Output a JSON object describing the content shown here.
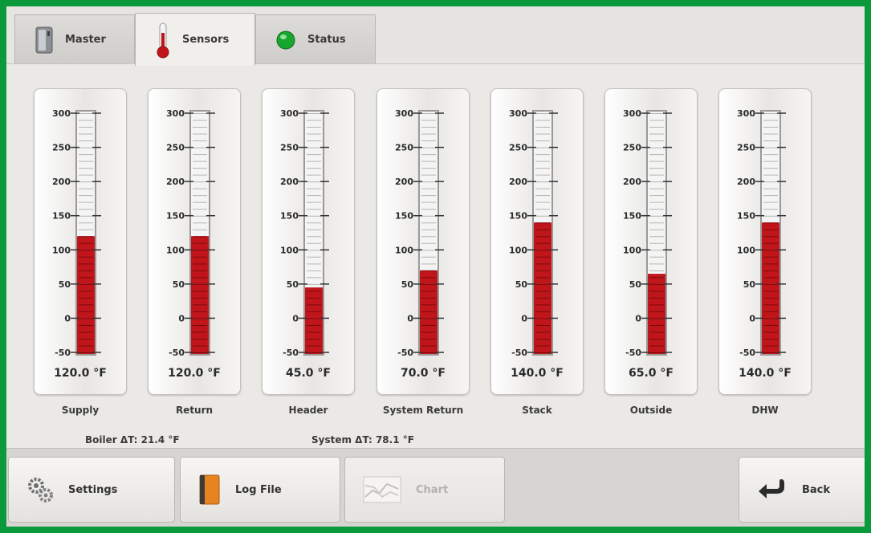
{
  "tabs": [
    {
      "label": "Master",
      "icon": "boiler-icon",
      "active": false
    },
    {
      "label": "Sensors",
      "icon": "thermometer-icon",
      "active": true
    },
    {
      "label": "Status",
      "icon": "green-led-icon",
      "active": false
    }
  ],
  "scale": {
    "min": -50,
    "max": 300,
    "ticks": [
      "300",
      "250",
      "200",
      "150",
      "100",
      "50",
      "0",
      "-50"
    ]
  },
  "sensors": [
    {
      "label": "Supply",
      "value": 120.0,
      "reading": "120.0 °F"
    },
    {
      "label": "Return",
      "value": 120.0,
      "reading": "120.0 °F"
    },
    {
      "label": "Header",
      "value": 45.0,
      "reading": "45.0 °F"
    },
    {
      "label": "System Return",
      "value": 70.0,
      "reading": "70.0 °F"
    },
    {
      "label": "Stack",
      "value": 140.0,
      "reading": "140.0 °F"
    },
    {
      "label": "Outside",
      "value": 65.0,
      "reading": "65.0 °F"
    },
    {
      "label": "DHW",
      "value": 140.0,
      "reading": "140.0 °F"
    }
  ],
  "deltas": {
    "boiler": "Boiler ΔT: 21.4 °F",
    "system": "System ΔT: 78.1 °F"
  },
  "toolbar": {
    "settings": "Settings",
    "log_file": "Log File",
    "chart": "Chart",
    "back": "Back"
  },
  "colors": {
    "frame": "#0a9a3c",
    "mercury": "#c0161b",
    "led": "#17a62e"
  }
}
